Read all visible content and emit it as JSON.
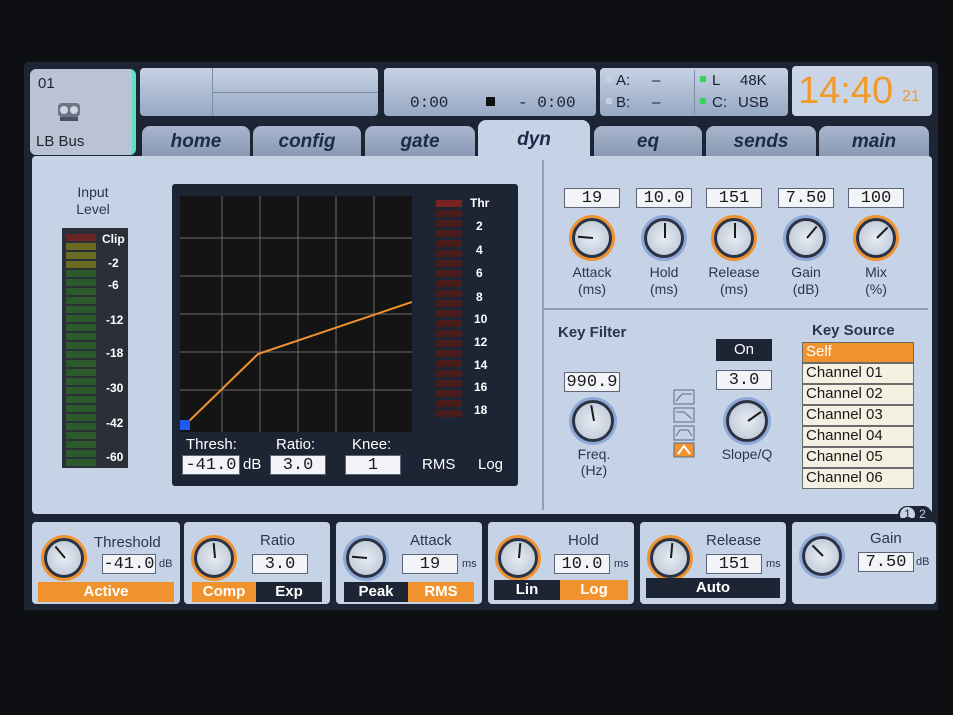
{
  "channel": {
    "number": "01",
    "name": "LB Bus"
  },
  "transport": {
    "time_elapsed": "0:00",
    "time_remaining": "- 0:00"
  },
  "io": {
    "a_label": "A:",
    "a_value": "–",
    "b_label": "B:",
    "b_value": "–",
    "l_label": "L",
    "l_value": "48K",
    "c_label": "C:",
    "c_value": "USB"
  },
  "clock": {
    "time": "14:40",
    "seconds": "21"
  },
  "tabs": [
    {
      "label": "home"
    },
    {
      "label": "config"
    },
    {
      "label": "gate"
    },
    {
      "label": "dyn"
    },
    {
      "label": "eq"
    },
    {
      "label": "sends"
    },
    {
      "label": "main"
    }
  ],
  "input_level": {
    "title": "Input Level",
    "scale": [
      "Clip",
      "-2",
      "-6",
      "-12",
      "-18",
      "-30",
      "-42",
      "-60"
    ]
  },
  "graph": {
    "gr_scale": [
      "Thr",
      "2",
      "4",
      "6",
      "8",
      "10",
      "12",
      "14",
      "16",
      "18"
    ],
    "thresh_label": "Thresh:",
    "thresh_value": "-41.0",
    "thresh_unit": "dB",
    "ratio_label": "Ratio:",
    "ratio_value": "3.0",
    "knee_label": "Knee:",
    "knee_value": "1",
    "rms_label": "RMS",
    "log_label": "Log"
  },
  "params": [
    {
      "label": "Attack",
      "unit": "(ms)",
      "value": "19"
    },
    {
      "label": "Hold",
      "unit": "(ms)",
      "value": "10.0"
    },
    {
      "label": "Release",
      "unit": "(ms)",
      "value": "151"
    },
    {
      "label": "Gain",
      "unit": "(dB)",
      "value": "7.50"
    },
    {
      "label": "Mix",
      "unit": "(%)",
      "value": "100"
    }
  ],
  "key_filter": {
    "title": "Key Filter",
    "freq_value": "990.9",
    "freq_label": "Freq.",
    "freq_unit": "(Hz)",
    "on_label": "On",
    "slope_value": "3.0",
    "slope_label": "Slope/Q"
  },
  "key_source": {
    "title": "Key Source",
    "items": [
      "Self",
      "Channel 01",
      "Channel 02",
      "Channel 03",
      "Channel 04",
      "Channel 05",
      "Channel 06"
    ],
    "selected": "Self"
  },
  "page_indicator": {
    "p1": "1",
    "p2": "2"
  },
  "bottom": {
    "threshold": {
      "label": "Threshold",
      "value": "-41.0",
      "unit": "dB",
      "button": "Active"
    },
    "ratio": {
      "label": "Ratio",
      "value": "3.0",
      "btn_a": "Comp",
      "btn_b": "Exp"
    },
    "attack": {
      "label": "Attack",
      "value": "19",
      "unit": "ms",
      "btn_a": "Peak",
      "btn_b": "RMS"
    },
    "hold": {
      "label": "Hold",
      "value": "10.0",
      "unit": "ms",
      "btn_a": "Lin",
      "btn_b": "Log"
    },
    "release": {
      "label": "Release",
      "value": "151",
      "unit": "ms",
      "button": "Auto"
    },
    "gain": {
      "label": "Gain",
      "value": "7.50",
      "unit": "dB"
    }
  },
  "colors": {
    "accent": "#f0922e",
    "panel": "#c6d3e6",
    "dark": "#1d2433",
    "curve": "#f0922e",
    "ring": "#8ea8d8"
  }
}
